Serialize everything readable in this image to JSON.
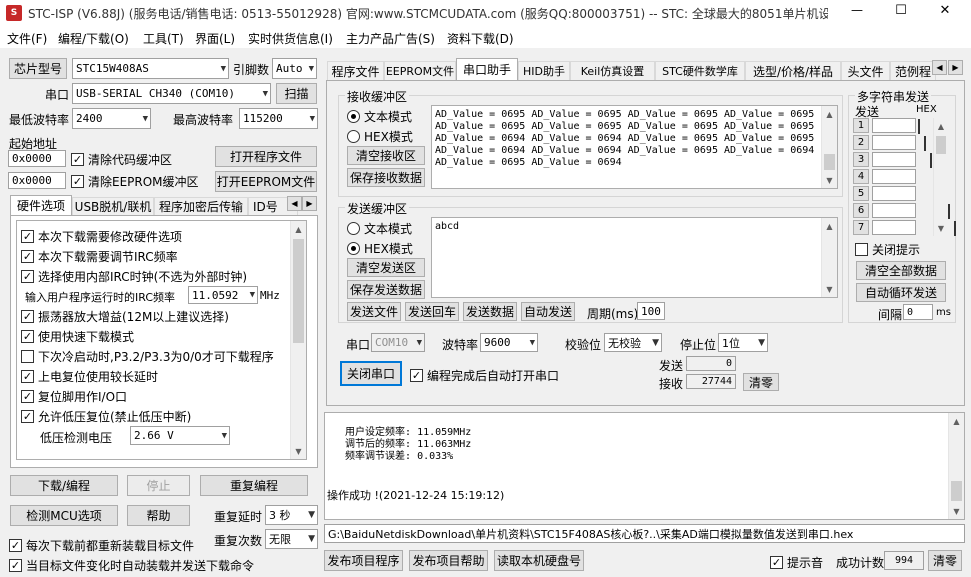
{
  "window": {
    "title": "STC-ISP (V6.88J) (服务电话/销售电话: 0513-55012928) 官网:www.STCMCUDATA.com  (服务QQ:800003751) -- STC: 全球最大的8051单片机设...",
    "minimize": "—",
    "maximize": "☐",
    "close": "✕"
  },
  "menu": [
    "文件(F)",
    "编程/下载(O)",
    "工具(T)",
    "界面(L)",
    "实时供货信息(I)",
    "主力产品广告(S)",
    "资料下载(D)"
  ],
  "left": {
    "chip_btn": "芯片型号",
    "chip_value": "STC15W408AS",
    "pin_label": "引脚数",
    "pin_value": "Auto",
    "port_label": "串口",
    "port_value": "USB-SERIAL CH340 (COM10)",
    "scan_btn": "扫描",
    "min_baud_label": "最低波特率",
    "min_baud_value": "2400",
    "max_baud_label": "最高波特率",
    "max_baud_value": "115200",
    "start_addr_label": "起始地址",
    "addr1": "0x0000",
    "clear_code": "清除代码缓冲区",
    "open_prog": "打开程序文件",
    "addr2": "0x0000",
    "clear_eeprom": "清除EEPROM缓冲区",
    "open_eeprom": "打开EEPROM文件",
    "tabs": [
      "硬件选项",
      "USB脱机/联机",
      "程序加密后传输",
      "ID号"
    ],
    "options": [
      {
        "label": "本次下载需要修改硬件选项",
        "checked": true
      },
      {
        "label": "本次下载需要调节IRC频率",
        "checked": true
      },
      {
        "label": "选择使用内部IRC时钟(不选为外部时钟)",
        "checked": true
      },
      {
        "label": "振荡器放大增益(12M以上建议选择)",
        "checked": true
      },
      {
        "label": "使用快速下载模式",
        "checked": true
      },
      {
        "label": "下次冷启动时,P3.2/P3.3为0/0才可下载程序",
        "checked": false
      },
      {
        "label": "上电复位使用较长延时",
        "checked": true
      },
      {
        "label": "复位脚用作I/O口",
        "checked": true
      },
      {
        "label": "允许低压复位(禁止低压中断)",
        "checked": true
      }
    ],
    "irc_label": "输入用户程序运行时的IRC频率",
    "irc_value": "11.0592",
    "irc_unit": "MHz",
    "lvd_label": "低压检测电压",
    "lvd_value": "2.66 V",
    "download_btn": "下载/编程",
    "stop_btn": "停止",
    "reprogram_btn": "重复编程",
    "detect_btn": "检测MCU选项",
    "help_btn": "帮助",
    "retry_delay_label": "重复延时",
    "retry_delay_value": "3 秒",
    "retry_count_label": "重复次数",
    "retry_count_value": "无限",
    "reload_each": "每次下载前都重新装载目标文件",
    "auto_reload": "当目标文件变化时自动装载并发送下载命令"
  },
  "right": {
    "tabs": [
      "程序文件",
      "EEPROM文件",
      "串口助手",
      "HID助手",
      "Keil仿真设置",
      "STC硬件数学库",
      "选型/价格/样品",
      "头文件",
      "范例程"
    ],
    "recv_group": "接收缓冲区",
    "recv_text_mode": "文本模式",
    "recv_hex_mode": "HEX模式",
    "clear_recv": "清空接收区",
    "save_recv": "保存接收数据",
    "recv_lines": [
      "AD_Value = 0695 AD_Value = 0695 AD_Value = 0695 AD_Value = 0695",
      "AD_Value = 0695 AD_Value = 0695 AD_Value = 0695 AD_Value = 0695",
      "AD_Value = 0694 AD_Value = 0694 AD_Value = 0695 AD_Value = 0695",
      "AD_Value = 0694 AD_Value = 0694 AD_Value = 0695 AD_Value = 0694",
      "AD_Value = 0695 AD_Value = 0694"
    ],
    "send_group": "发送缓冲区",
    "send_text_mode": "文本模式",
    "send_hex_mode": "HEX模式",
    "clear_send": "清空发送区",
    "save_send": "保存发送数据",
    "send_text": "abcd",
    "send_file": "发送文件",
    "send_echo": "发送回车",
    "send_data": "发送数据",
    "auto_send": "自动发送",
    "period_label": "周期(ms)",
    "period_value": "100",
    "multi_group": "多字符串发送",
    "multi_send_hdr": "发送",
    "multi_hex_hdr": "HEX",
    "multi_rows": [
      "1",
      "2",
      "3",
      "4",
      "5",
      "6",
      "7"
    ],
    "close_hint": "关闭提示",
    "clear_all": "清空全部数据",
    "auto_loop": "自动循环发送",
    "interval_label": "间隔",
    "interval_value": "0",
    "interval_unit": "ms",
    "com_label": "串口",
    "com_value": "COM10",
    "baud_label": "波特率",
    "baud_value": "9600",
    "parity_label": "校验位",
    "parity_value": "无校验",
    "stop_label": "停止位",
    "stop_value": "1位",
    "close_port": "关闭串口",
    "auto_open": "编程完成后自动打开串口",
    "sent_label": "发送",
    "sent_value": "0",
    "recv_label": "接收",
    "recv_value": "27744",
    "clear_count": "清零",
    "log_lines": [
      "  用户设定频率: 11.059MHz",
      "  调节后的频率: 11.063MHz",
      "  频率调节误差: 0.033%"
    ],
    "log_success": "操作成功 !(2021-12-24 15:19:12)",
    "path": "G:\\BaiduNetdiskDownload\\单片机资料\\STC15F408AS核心板?..\\采集AD端口模拟量数值发送到串口.hex",
    "publish_prog": "发布项目程序",
    "publish_help": "发布项目帮助",
    "read_disk": "读取本机硬盘号",
    "beep": "提示音",
    "success_count_label": "成功计数",
    "success_count_value": "994",
    "clear_success": "清零"
  }
}
